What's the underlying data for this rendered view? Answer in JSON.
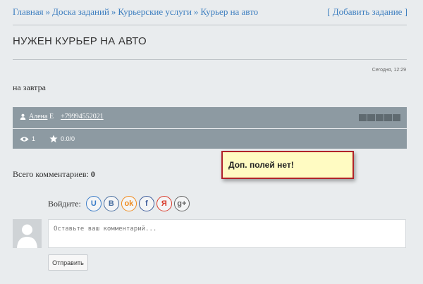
{
  "breadcrumbs": [
    {
      "label": "Главная"
    },
    {
      "label": "Доска заданий"
    },
    {
      "label": "Курьерские услуги"
    },
    {
      "label": "Курьер на авто"
    }
  ],
  "breadcrumb_separator": "»",
  "add_task_label": "[ Добавить задание ]",
  "task": {
    "title": "НУЖЕН КУРЬЕР НА АВТО",
    "date": "Сегодня, 12:29",
    "description": "на завтра",
    "author_name": "Алена",
    "author_suffix": "Е",
    "phone": "+79994552021",
    "views": "1",
    "rating": "0.0/0"
  },
  "notice": "Доп. полей нет!",
  "comments": {
    "count_label": "Всего комментариев:",
    "count": "0",
    "login_label": "Войдите:",
    "placeholder": "Оставьте ваш комментарий...",
    "submit_label": "Отправить"
  },
  "social": [
    {
      "name": "ucoz",
      "glyph": "U",
      "color": "#3a7cc8"
    },
    {
      "name": "vkontakte",
      "glyph": "B",
      "color": "#4a6fa0"
    },
    {
      "name": "odnoklassniki",
      "glyph": "ok",
      "color": "#f08a1c"
    },
    {
      "name": "facebook",
      "glyph": "f",
      "color": "#3b5a9a"
    },
    {
      "name": "yandex",
      "glyph": "Я",
      "color": "#d93a2b"
    },
    {
      "name": "google-plus",
      "glyph": "g+",
      "color": "#666666"
    }
  ]
}
